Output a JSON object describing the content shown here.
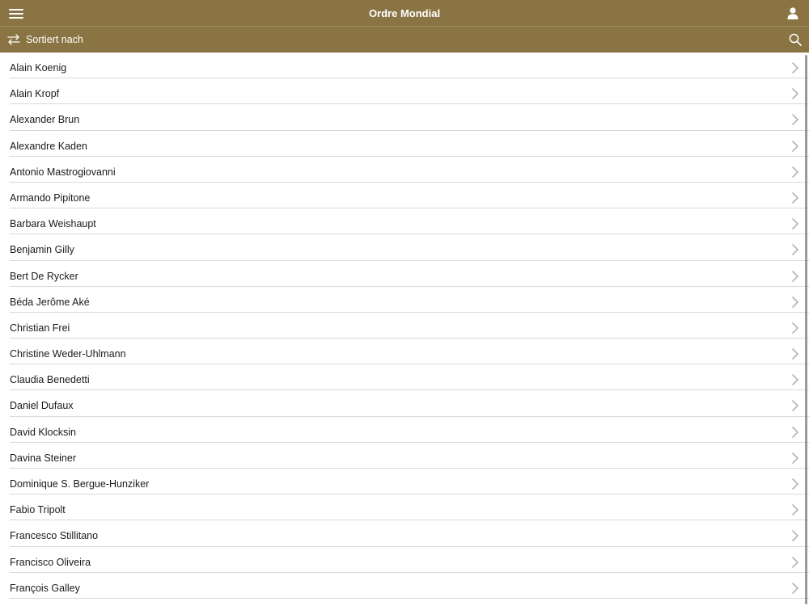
{
  "header": {
    "title": "Ordre Mondial",
    "menu_icon": "hamburger-menu-icon",
    "user_icon": "user-icon",
    "background": "#8a7444"
  },
  "sortbar": {
    "sort_label": "Sortiert nach",
    "sort_icon": "swap-arrows-icon",
    "search_icon": "search-icon"
  },
  "list": {
    "items": [
      "Alain Koenig",
      "Alain Kropf",
      "Alexander Brun",
      "Alexandre Kaden",
      "Antonio Mastrogiovanni",
      "Armando Pipitone",
      "Barbara Weishaupt",
      "Benjamin Gilly",
      "Bert De Rycker",
      "Béda Jerôme Aké",
      "Christian Frei",
      "Christine Weder-Uhlmann",
      "Claudia Benedetti",
      "Daniel Dufaux",
      "David Klocksin",
      "Davina Steiner",
      "Dominique S. Bergue-Hunziker",
      "Fabio Tripolt",
      "Francesco Stillitano",
      "Francisco Oliveira",
      "François Galley"
    ],
    "row_icon": "chevron-right-icon"
  }
}
